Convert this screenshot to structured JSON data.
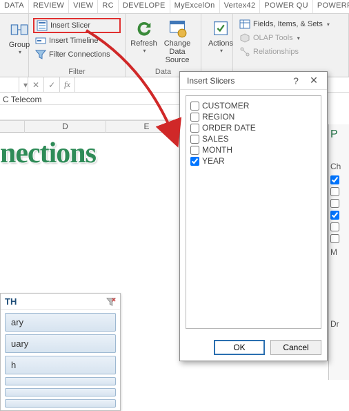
{
  "tabs": [
    "DATA",
    "REVIEW",
    "VIEW",
    "RC",
    "DEVELOPE",
    "MyExcelOn",
    "Vertex42",
    "POWER QU",
    "POWERPIV"
  ],
  "ribbon": {
    "group_btn": "Group",
    "insert_slicer": "Insert Slicer",
    "insert_timeline": "Insert Timeline",
    "filter_connections": "Filter Connections",
    "filter_label": "Filter",
    "refresh": "Refresh",
    "change_data_source": "Change Data\nSource",
    "data_label": "Data",
    "actions": "Actions",
    "fields_items_sets": "Fields, Items, & Sets",
    "olap_tools": "OLAP Tools",
    "relationships": "Relationships"
  },
  "formula": {
    "cell_value": "C Telecom"
  },
  "columns": {
    "d": "D",
    "e": "E"
  },
  "bigtext": "nections",
  "slicer": {
    "title": "TH",
    "items": [
      "ary",
      "uary",
      "h",
      "",
      "",
      ""
    ]
  },
  "taskpane": {
    "header": "P",
    "choose": "Ch",
    "more": "M",
    "drag": "Dr"
  },
  "dialog": {
    "title": "Insert Slicers",
    "fields": [
      {
        "label": "CUSTOMER",
        "checked": false
      },
      {
        "label": "REGION",
        "checked": false
      },
      {
        "label": "ORDER DATE",
        "checked": false
      },
      {
        "label": "SALES",
        "checked": false
      },
      {
        "label": "MONTH",
        "checked": false
      },
      {
        "label": "YEAR",
        "checked": true
      }
    ],
    "ok": "OK",
    "cancel": "Cancel"
  }
}
